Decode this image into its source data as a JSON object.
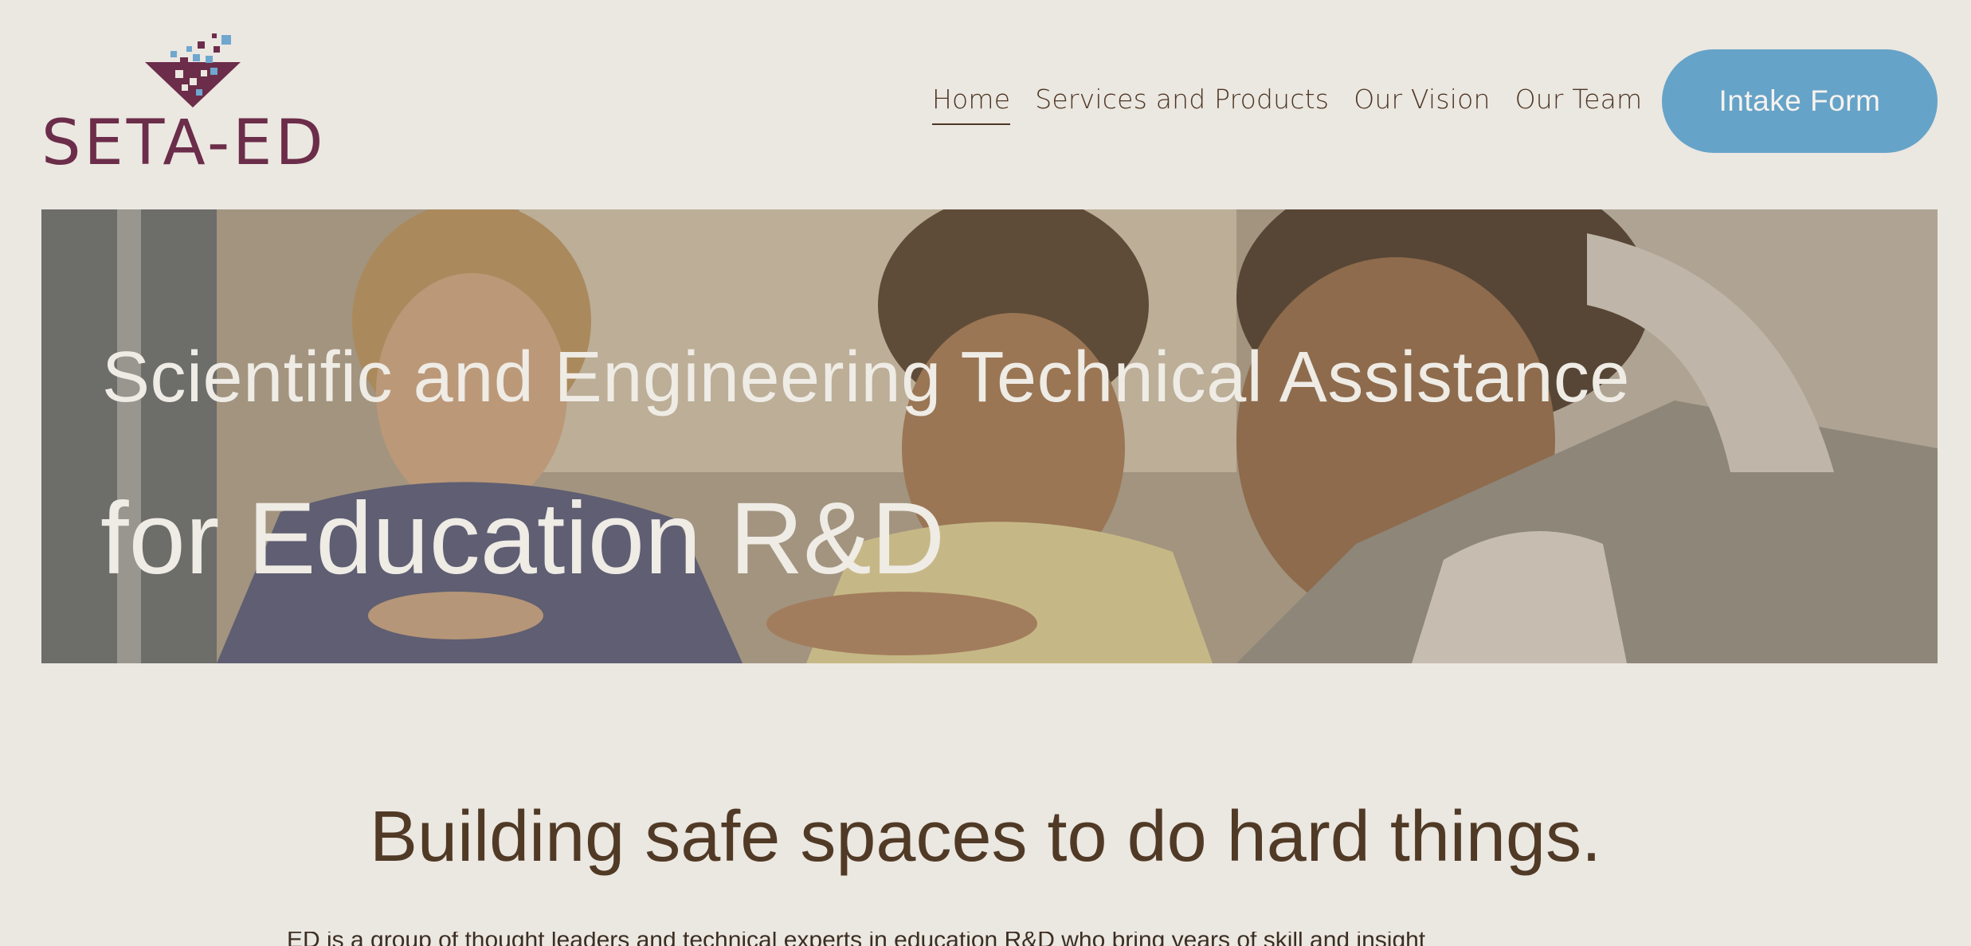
{
  "brand": {
    "name": "SETA-ED",
    "primary_color": "#6b2d49",
    "accent_color": "#66a3c8"
  },
  "nav": {
    "items": [
      {
        "label": "Home",
        "active": true
      },
      {
        "label": "Services and Products",
        "active": false
      },
      {
        "label": "Our Vision",
        "active": false
      },
      {
        "label": "Our Team",
        "active": false
      }
    ],
    "cta_label": "Intake Form"
  },
  "hero": {
    "line1": "Scientific and Engineering Technical Assistance",
    "line2": "for Education R&D",
    "image": "three-students-leaning-over-desk-photo"
  },
  "tagline": "Building safe spaces to do hard things.",
  "body_peek": "ED is a group of thought leaders and technical experts in education R&D who bring years of skill and insight"
}
